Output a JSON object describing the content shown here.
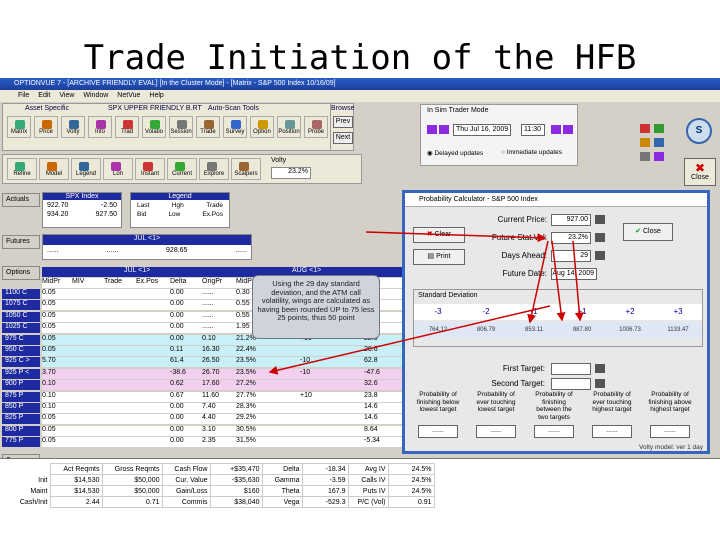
{
  "slide_title": "Trade Initiation of the HFB",
  "window": {
    "title": "OPTIONVUE 7 - [ARCHIVE FRIENDLY EVAL]  [In the Cluster Mode] - [Matrix - S&P 500 Index 10/16/09]",
    "menu": [
      "File",
      "Edit",
      "View",
      "Window",
      "NetVue",
      "Help"
    ]
  },
  "toolbar": {
    "sections": [
      "Asset Specific",
      "SPX UPPER FRIENDLY B.RT",
      "Auto-Scan Tools",
      "Browse"
    ],
    "buttons_row1": [
      "Matrix",
      "Price Chart",
      "Volty Chart",
      "Info",
      "Trad",
      "Volatio",
      "Session",
      "Trade Review",
      "Survey",
      "Option",
      "Position",
      "Probe"
    ],
    "buttons_row2": [
      "Refine",
      "Model",
      "Legend",
      "Lon",
      "Instant",
      "Current Trades",
      "Explore Cluster",
      "Scalpers"
    ],
    "browse_buttons": [
      "Prev",
      "Next"
    ],
    "volty_label": "Volty",
    "volty_value": "23.2%"
  },
  "sim_mode": {
    "title": "In Sim Trader Mode",
    "date": "Thu Jul 16, 2009",
    "time": "11:30",
    "options": [
      "Delayed updates",
      "Immediate updates"
    ]
  },
  "right_buttons": {
    "close_label": "Close",
    "s_label": "S"
  },
  "sidebar": {
    "actuals": "Actuals",
    "futures": "Futures",
    "options": "Options",
    "summary": "Summary"
  },
  "actuals_panel": {
    "header": "SPX Index",
    "legend_header": "Legend",
    "values": [
      "922.70",
      "-2.50",
      "934.20",
      "927.50"
    ],
    "legend_items": [
      "Last",
      "Hgh",
      "Trade",
      "Bid",
      "Low",
      "Ex.Pos"
    ]
  },
  "futures_panel": {
    "header": "JUL <1>",
    "values": [
      "......",
      "......",
      "928.65",
      "......"
    ]
  },
  "options_header": {
    "col_group_a": "JUL <1>",
    "col_group_b": "AUG <1>"
  },
  "columns": [
    "MidPr",
    "MIV",
    "Trade",
    "Ex.Pos",
    "Delta",
    "OrigPr",
    "MidPr",
    "MIV",
    "Trade",
    "Ex.Pos",
    "Delta"
  ],
  "option_rows": [
    {
      "strike": "1100 C",
      "cells": [
        "0.05",
        "",
        "",
        "",
        "0.00",
        "......",
        "0.30",
        "21.2%",
        "",
        "",
        "0.49"
      ]
    },
    {
      "strike": "1075 C",
      "cells": [
        "0.05",
        "",
        "",
        "",
        "0.00",
        "......",
        "0.55",
        "21.5%",
        "",
        "",
        "1.10"
      ]
    },
    {
      "strike": "1050 C",
      "cells": [
        "0.05",
        "",
        "",
        "",
        "0.00",
        "......",
        "0.55",
        "22.3%",
        "",
        "",
        "1.78"
      ]
    },
    {
      "strike": "1025 C",
      "cells": [
        "0.05",
        "",
        "",
        "",
        "0.00",
        "......",
        "1.95",
        "22.5%",
        "",
        "",
        "5.40"
      ]
    },
    {
      "strike": "975 C",
      "cells": [
        "0.05",
        "",
        "",
        "",
        "0.00",
        "0.10",
        "21.2%",
        "",
        "+10",
        "",
        "22.9"
      ]
    },
    {
      "strike": "950 C",
      "cells": [
        "0.05",
        "",
        "",
        "",
        "0.11",
        "16.30",
        "22.4%",
        "",
        "",
        "",
        "26.6"
      ]
    },
    {
      "strike": "925 C >",
      "cells": [
        "5.70",
        "",
        "",
        "",
        "61.4",
        "26.50",
        "23.5%",
        "",
        "-10",
        "",
        "62.8"
      ]
    },
    {
      "strike": "925 P <",
      "cells": [
        "3.70",
        "",
        "",
        "",
        "-38.6",
        "26.70",
        "23.5%",
        "",
        "-10",
        "",
        "-47.6"
      ]
    },
    {
      "strike": "900 P",
      "cells": [
        "0.10",
        "",
        "",
        "",
        "0.62",
        "17.60",
        "27.2%",
        "",
        "",
        "",
        "32.6"
      ]
    },
    {
      "strike": "875 P",
      "cells": [
        "0.10",
        "",
        "",
        "",
        "0.67",
        "11.60",
        "27.7%",
        "",
        "+10",
        "",
        "23.8"
      ]
    },
    {
      "strike": "850 P",
      "cells": [
        "0.10",
        "",
        "",
        "",
        "0.00",
        "7.40",
        "28.3%",
        "",
        "",
        "",
        "14.6"
      ]
    },
    {
      "strike": "825 P",
      "cells": [
        "0.05",
        "",
        "",
        "",
        "0.00",
        "4.40",
        "29.2%",
        "",
        "",
        "",
        "14.6"
      ]
    },
    {
      "strike": "800 P",
      "cells": [
        "0.05",
        "",
        "",
        "",
        "0.00",
        "3.10",
        "30.5%",
        "",
        "",
        "",
        "8.64"
      ]
    },
    {
      "strike": "775 P",
      "cells": [
        "0.05",
        "",
        "",
        "",
        "0.00",
        "2.35",
        "31.5%",
        "",
        "",
        "",
        "-5.34"
      ]
    }
  ],
  "note": "Using the 29 day standard deviation, and the ATM call volatility, wings are calculated as having been rounded UP to 75 less 25 points, thus 50 point",
  "probability_dialog": {
    "title": "Probability Calculator - S&P 500 Index",
    "labels": {
      "current_price": "Current Price:",
      "future_stat_vol": "Future Stat.Vol:",
      "days_ahead": "Days Ahead:",
      "future_date": "Future Date:",
      "first_target": "First Target:",
      "second_target": "Second Target:"
    },
    "values": {
      "current_price": "927.00",
      "future_stat_vol": "23.2%",
      "days_ahead": "29",
      "future_date": "Aug 14, 2009"
    },
    "buttons": {
      "clear": "Clear",
      "print": "Print",
      "close": "Close"
    },
    "sd_title": "Standard Deviation",
    "sd_headers": [
      "-3",
      "-2",
      "-1",
      "+1",
      "+2",
      "+3"
    ],
    "sd_values": [
      "764.12",
      "806.79",
      "853.11",
      "987.80",
      "1006.73",
      "1133.47"
    ],
    "probabilities": [
      "Probability of finishing below lowest target",
      "Probability of ever touching lowest target",
      "Probability of finishing between the two targets",
      "Probability of ever touching highest target",
      "Probability of finishing above highest target"
    ],
    "prob_values": [
      "......",
      "......",
      "......",
      "......",
      "......"
    ],
    "footer": "Volty model: ver 1 day"
  },
  "summary": {
    "rows": [
      {
        "label": "",
        "cells": [
          "Act Reqmts",
          "Gross Reqmts",
          "Cash Flow",
          "+$35,470",
          "Delta",
          "-18.34",
          "Avg IV",
          "24.5%"
        ]
      },
      {
        "label": "Init",
        "cells": [
          "$14,530",
          "$50,000",
          "Cur. Value",
          "-$35,630",
          "Gamma",
          "-3.59",
          "Calls IV",
          "24.5%"
        ]
      },
      {
        "label": "Maint",
        "cells": [
          "$14,530",
          "$50,000",
          "Gain/Loss",
          "$160",
          "Theta",
          "167.9",
          "Puts IV",
          "24.5%"
        ]
      },
      {
        "label": "Cash/Init",
        "cells": [
          "2.44",
          "0.71",
          "Commis",
          "$38,040",
          "Vega",
          "-529.3",
          "P/C (Vol)",
          "0.91"
        ]
      }
    ]
  }
}
